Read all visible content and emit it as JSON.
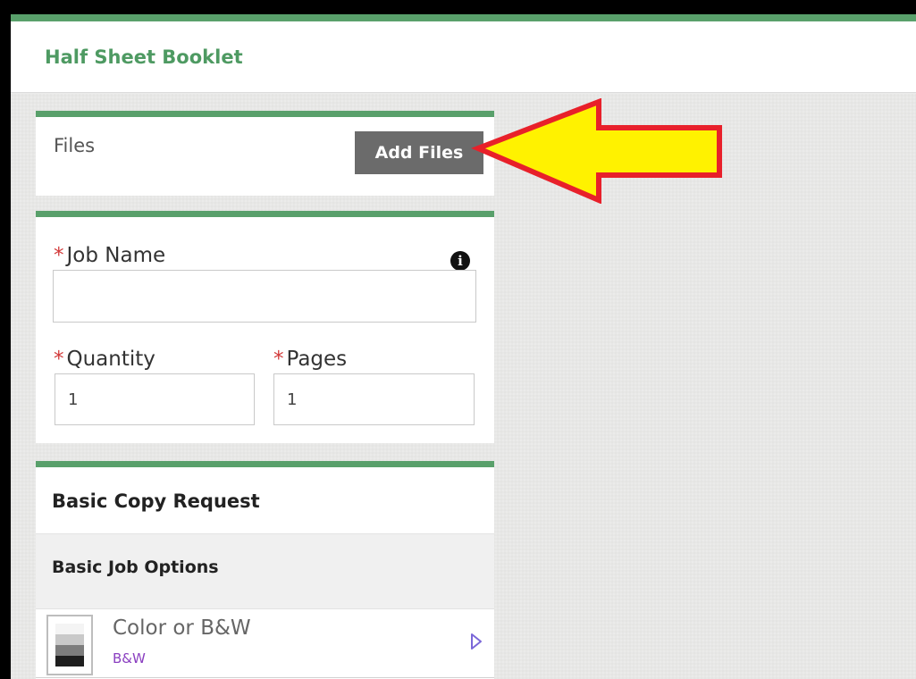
{
  "header": {
    "title": "Half Sheet Booklet"
  },
  "files": {
    "label": "Files",
    "add_button": "Add Files"
  },
  "job": {
    "job_name_label": "Job Name",
    "job_name_value": "",
    "required_mark": "*",
    "quantity_label": "Quantity",
    "quantity_value": "1",
    "pages_label": "Pages",
    "pages_value": "1",
    "info_icon": "i"
  },
  "basic": {
    "title": "Basic Copy Request",
    "options_title": "Basic Job Options",
    "options": [
      {
        "label": "Color or B&W",
        "value": "B&W",
        "icon": "bw-swatch-icon"
      }
    ]
  },
  "colors": {
    "accent": "#59a06b",
    "title": "#4e9a62",
    "button": "#6b6b6b",
    "required": "#d23a3a",
    "option_value": "#8a3fc0",
    "callout_fill": "#fff200",
    "callout_stroke": "#e8202a"
  }
}
